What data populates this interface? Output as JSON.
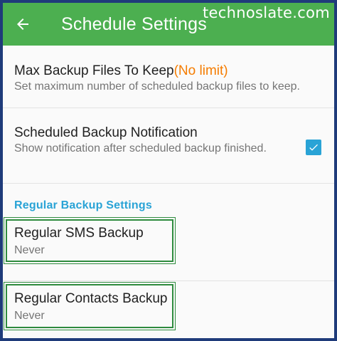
{
  "appbar": {
    "title": "Schedule Settings",
    "back_icon": "arrow-left-icon",
    "background": "#4caf50"
  },
  "watermark": "technoslate.com",
  "settings": {
    "max_backup": {
      "title": "Max Backup Files To Keep",
      "value": "(No limit)",
      "summary": "Set maximum number of scheduled backup files to keep."
    },
    "notification": {
      "title": "Scheduled Backup Notification",
      "summary": "Show notification after scheduled backup finished.",
      "checked": true
    },
    "section_header": "Regular Backup Settings",
    "sms": {
      "title": "Regular SMS Backup",
      "summary": "Never"
    },
    "contacts": {
      "title": "Regular Contacts Backup",
      "summary": "Never"
    }
  },
  "colors": {
    "accent_orange": "#f57c00",
    "accent_blue": "#29a3d6",
    "highlight_green": "#2e8b3e",
    "frame": "#1f3b7a"
  }
}
